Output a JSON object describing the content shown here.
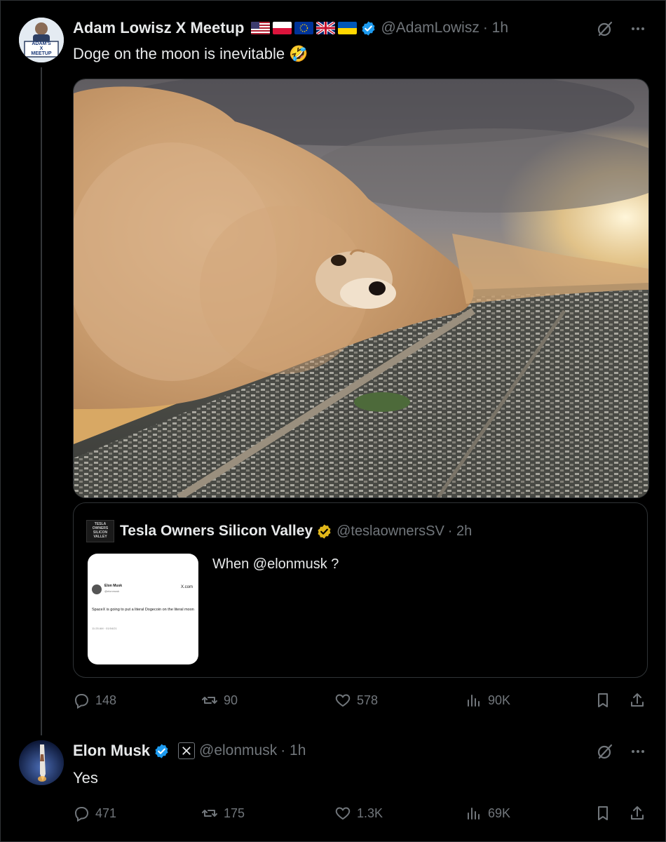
{
  "tweet": {
    "author_name": "Adam Lowisz X Meetup",
    "handle": "@AdamLowisz",
    "time": "· 1h",
    "avatar_text": [
      "ADAM'S",
      "X",
      "MEETUP"
    ],
    "text": "Doge on the moon is inevitable",
    "emoji": "🤣",
    "flags": [
      "us-flag",
      "poland-flag",
      "eu-flag",
      "uk-flag",
      "ukraine-flag"
    ],
    "actions": {
      "replies": "148",
      "reposts": "90",
      "likes": "578",
      "views": "90K"
    }
  },
  "quote": {
    "author_name": "Tesla Owners Silicon Valley",
    "handle": "@teslaownersSV",
    "time": "· 2h",
    "logo_text": [
      "TESLA",
      "OWNERS",
      "SILICON",
      "VALLEY"
    ],
    "text": "When @elonmusk ?",
    "thumb": {
      "name": "Elon Musk",
      "handle": "@elonmusk",
      "site": "X.com",
      "text": "SpaceX is going to put a literal Dogecoin on the literal moon",
      "meta": "11:25 AM · 01/04/21"
    }
  },
  "reply": {
    "author_name": "Elon Musk",
    "handle": "@elonmusk",
    "time": "· 1h",
    "text": "Yes",
    "actions": {
      "replies": "471",
      "reposts": "175",
      "likes": "1.3K",
      "views": "69K"
    }
  },
  "colors": {
    "background": "#000000",
    "text": "#e7e9ea",
    "muted": "#71767b",
    "verified_blue": "#1d9bf0",
    "verified_gold": "#e2b719",
    "border": "#2f3336"
  }
}
